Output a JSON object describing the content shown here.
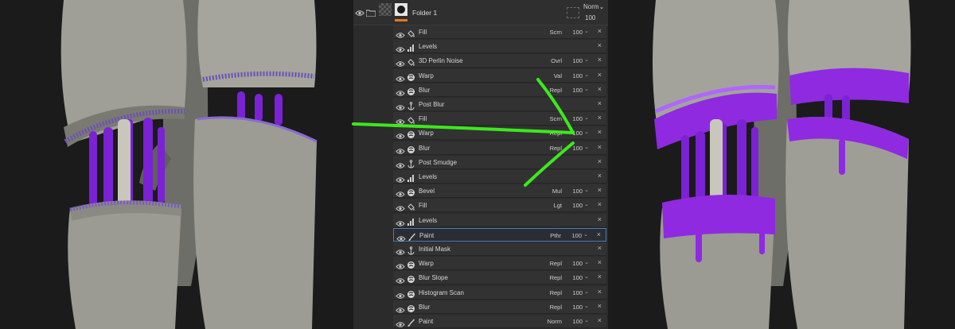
{
  "folder": {
    "name": "Folder 1",
    "blend": "Norm",
    "opacity": "100"
  },
  "layers": [
    {
      "name": "Fill",
      "icon": "fill-icon",
      "blend": "Scrn",
      "opacity": "100"
    },
    {
      "name": "Levels",
      "icon": "levels-icon",
      "blend": "",
      "opacity": ""
    },
    {
      "name": "3D Perlin Noise",
      "icon": "fill-icon",
      "blend": "Ovrl",
      "opacity": "100"
    },
    {
      "name": "Warp",
      "icon": "filter-icon",
      "blend": "Val",
      "opacity": "100"
    },
    {
      "name": "Blur",
      "icon": "filter-icon",
      "blend": "Repl",
      "opacity": "100"
    },
    {
      "name": "Post Blur",
      "icon": "anchor-icon",
      "blend": "",
      "opacity": ""
    },
    {
      "name": "Fill",
      "icon": "fill-icon",
      "blend": "Scrn",
      "opacity": "100"
    },
    {
      "name": "Warp",
      "icon": "filter-icon",
      "blend": "Repl",
      "opacity": "100"
    },
    {
      "name": "Blur",
      "icon": "filter-icon",
      "blend": "Repl",
      "opacity": "100"
    },
    {
      "name": "Post Smudge",
      "icon": "anchor-icon",
      "blend": "",
      "opacity": ""
    },
    {
      "name": "Levels",
      "icon": "levels-icon",
      "blend": "",
      "opacity": ""
    },
    {
      "name": "Bevel",
      "icon": "filter-icon",
      "blend": "Mul",
      "opacity": "100"
    },
    {
      "name": "Fill",
      "icon": "fill-icon",
      "blend": "Lgt",
      "opacity": "100"
    },
    {
      "name": "Levels",
      "icon": "levels-icon",
      "blend": "",
      "opacity": ""
    },
    {
      "name": "Paint",
      "icon": "brush-icon",
      "blend": "Pthr",
      "opacity": "100",
      "selected": true
    },
    {
      "name": "Initial Mask",
      "icon": "anchor-icon",
      "blend": "",
      "opacity": ""
    },
    {
      "name": "Warp",
      "icon": "filter-icon",
      "blend": "Repl",
      "opacity": "100"
    },
    {
      "name": "Blur Slope",
      "icon": "filter-icon",
      "blend": "Repl",
      "opacity": "100"
    },
    {
      "name": "Histogram Scan",
      "icon": "filter-icon",
      "blend": "Repl",
      "opacity": "100"
    },
    {
      "name": "Blur",
      "icon": "filter-icon",
      "blend": "Repl",
      "opacity": "100"
    },
    {
      "name": "Paint",
      "icon": "brush-icon",
      "blend": "Norm",
      "opacity": "100"
    }
  ],
  "colors": {
    "accent_orange": "#e6771a",
    "selection_blue": "#4a7ab8",
    "annotation_green": "#3de81e",
    "slime_purple": "#8a2be2",
    "model_gray": "#a7a79f"
  }
}
